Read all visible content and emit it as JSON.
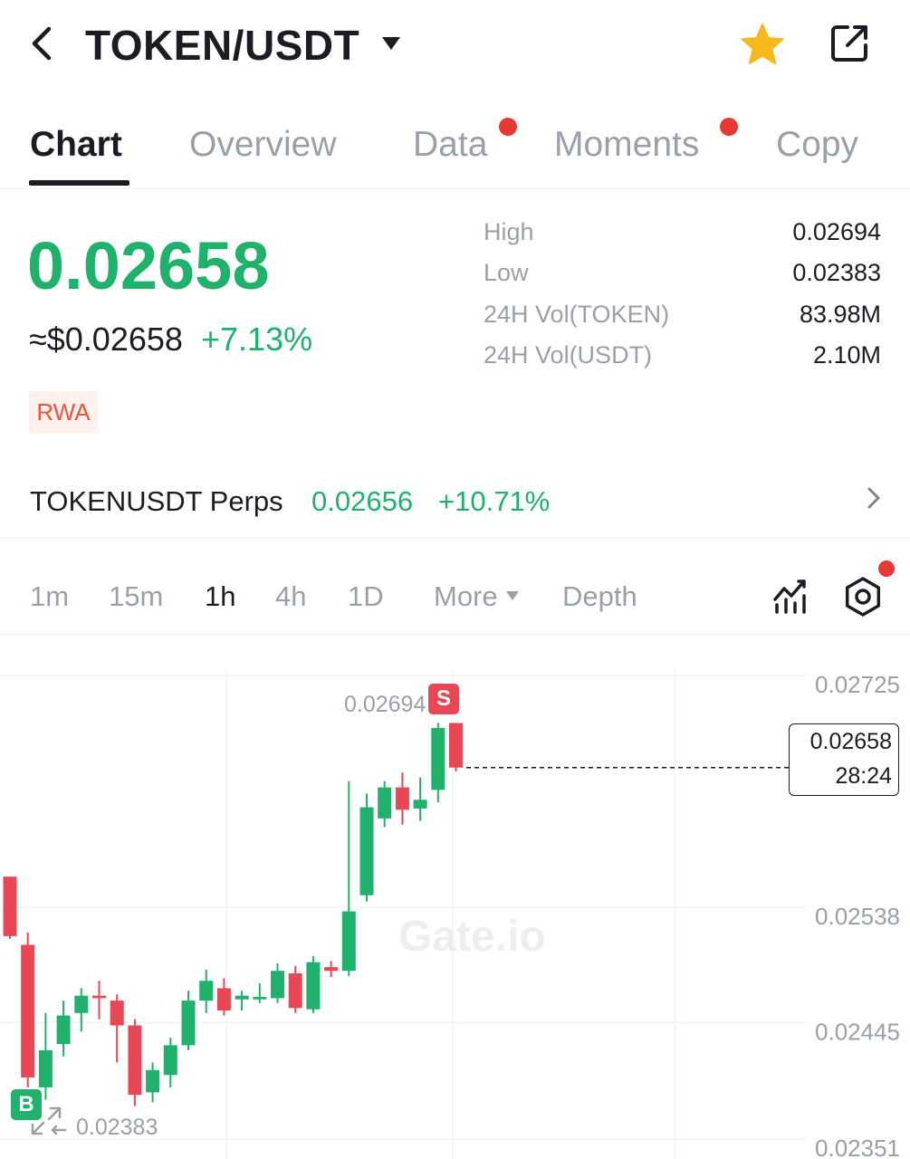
{
  "header": {
    "pair": "TOKEN/USDT",
    "icons": [
      "back-arrow-icon",
      "caret-down-icon",
      "star-icon",
      "share-icon"
    ],
    "star_color": "#f5b91e"
  },
  "tabs": [
    {
      "label": "Chart",
      "active": true
    },
    {
      "label": "Overview",
      "active": false
    },
    {
      "label": "Data",
      "active": false,
      "badge": true
    },
    {
      "label": "Moments",
      "active": false,
      "badge": true
    },
    {
      "label": "Copy",
      "active": false
    }
  ],
  "price": {
    "last": "0.02658",
    "usd": "≈$0.02658",
    "change": "+7.13%",
    "tag": "RWA"
  },
  "stats": {
    "high_label": "High",
    "high_value": "0.02694",
    "low_label": "Low",
    "low_value": "0.02383",
    "vol_token_label": "24H Vol(TOKEN)",
    "vol_token_value": "83.98M",
    "vol_usdt_label": "24H Vol(USDT)",
    "vol_usdt_value": "2.10M"
  },
  "perps": {
    "name": "TOKENUSDT Perps",
    "price": "0.02656",
    "change": "+10.71%"
  },
  "timeframes": {
    "items": [
      "1m",
      "15m",
      "1h",
      "4h",
      "1D"
    ],
    "active": "1h",
    "more": "More",
    "depth": "Depth"
  },
  "colors": {
    "up": "#20b26c",
    "down": "#e84855",
    "text": "#1a1d23",
    "muted": "#9aa0a8"
  },
  "chart_data": {
    "type": "candlestick",
    "y_ticks": [
      "0.02725",
      "0.02538",
      "0.02445",
      "0.02351"
    ],
    "current_price": "0.02658",
    "countdown": "28:24",
    "high_marker": "0.02694",
    "low_marker": "0.02383",
    "markers": {
      "sell": "S",
      "buy": "B"
    },
    "watermark": "Gate.io",
    "ylim": [
      0.02351,
      0.02725
    ],
    "candles": [
      {
        "o": 0.0257,
        "h": 0.0257,
        "l": 0.0252,
        "c": 0.02522
      },
      {
        "o": 0.02515,
        "h": 0.02525,
        "l": 0.024,
        "c": 0.02408
      },
      {
        "o": 0.024,
        "h": 0.0246,
        "l": 0.0239,
        "c": 0.0243
      },
      {
        "o": 0.02435,
        "h": 0.0247,
        "l": 0.02425,
        "c": 0.02458
      },
      {
        "o": 0.0246,
        "h": 0.0248,
        "l": 0.02445,
        "c": 0.02474
      },
      {
        "o": 0.02474,
        "h": 0.02486,
        "l": 0.02455,
        "c": 0.02472
      },
      {
        "o": 0.0247,
        "h": 0.02475,
        "l": 0.0242,
        "c": 0.0245
      },
      {
        "o": 0.0245,
        "h": 0.02455,
        "l": 0.02385,
        "c": 0.02394
      },
      {
        "o": 0.02396,
        "h": 0.0242,
        "l": 0.02388,
        "c": 0.02414
      },
      {
        "o": 0.0241,
        "h": 0.0244,
        "l": 0.024,
        "c": 0.02434
      },
      {
        "o": 0.02434,
        "h": 0.02478,
        "l": 0.0243,
        "c": 0.0247
      },
      {
        "o": 0.0247,
        "h": 0.02495,
        "l": 0.0246,
        "c": 0.02486
      },
      {
        "o": 0.0248,
        "h": 0.02488,
        "l": 0.02458,
        "c": 0.02462
      },
      {
        "o": 0.02471,
        "h": 0.02478,
        "l": 0.02462,
        "c": 0.02474
      },
      {
        "o": 0.02471,
        "h": 0.02484,
        "l": 0.02468,
        "c": 0.02473
      },
      {
        "o": 0.02472,
        "h": 0.025,
        "l": 0.02468,
        "c": 0.02494
      },
      {
        "o": 0.02492,
        "h": 0.02498,
        "l": 0.0246,
        "c": 0.02464
      },
      {
        "o": 0.02463,
        "h": 0.02506,
        "l": 0.0246,
        "c": 0.02501
      },
      {
        "o": 0.02497,
        "h": 0.02502,
        "l": 0.02489,
        "c": 0.02494
      },
      {
        "o": 0.02494,
        "h": 0.02647,
        "l": 0.0249,
        "c": 0.02542
      },
      {
        "o": 0.02555,
        "h": 0.02637,
        "l": 0.0255,
        "c": 0.02626
      },
      {
        "o": 0.02617,
        "h": 0.02647,
        "l": 0.0261,
        "c": 0.02642
      },
      {
        "o": 0.02642,
        "h": 0.02654,
        "l": 0.02612,
        "c": 0.02624
      },
      {
        "o": 0.02625,
        "h": 0.0265,
        "l": 0.02615,
        "c": 0.02632
      },
      {
        "o": 0.0264,
        "h": 0.02694,
        "l": 0.0263,
        "c": 0.0269
      },
      {
        "o": 0.02694,
        "h": 0.02694,
        "l": 0.02655,
        "c": 0.02658
      }
    ]
  }
}
